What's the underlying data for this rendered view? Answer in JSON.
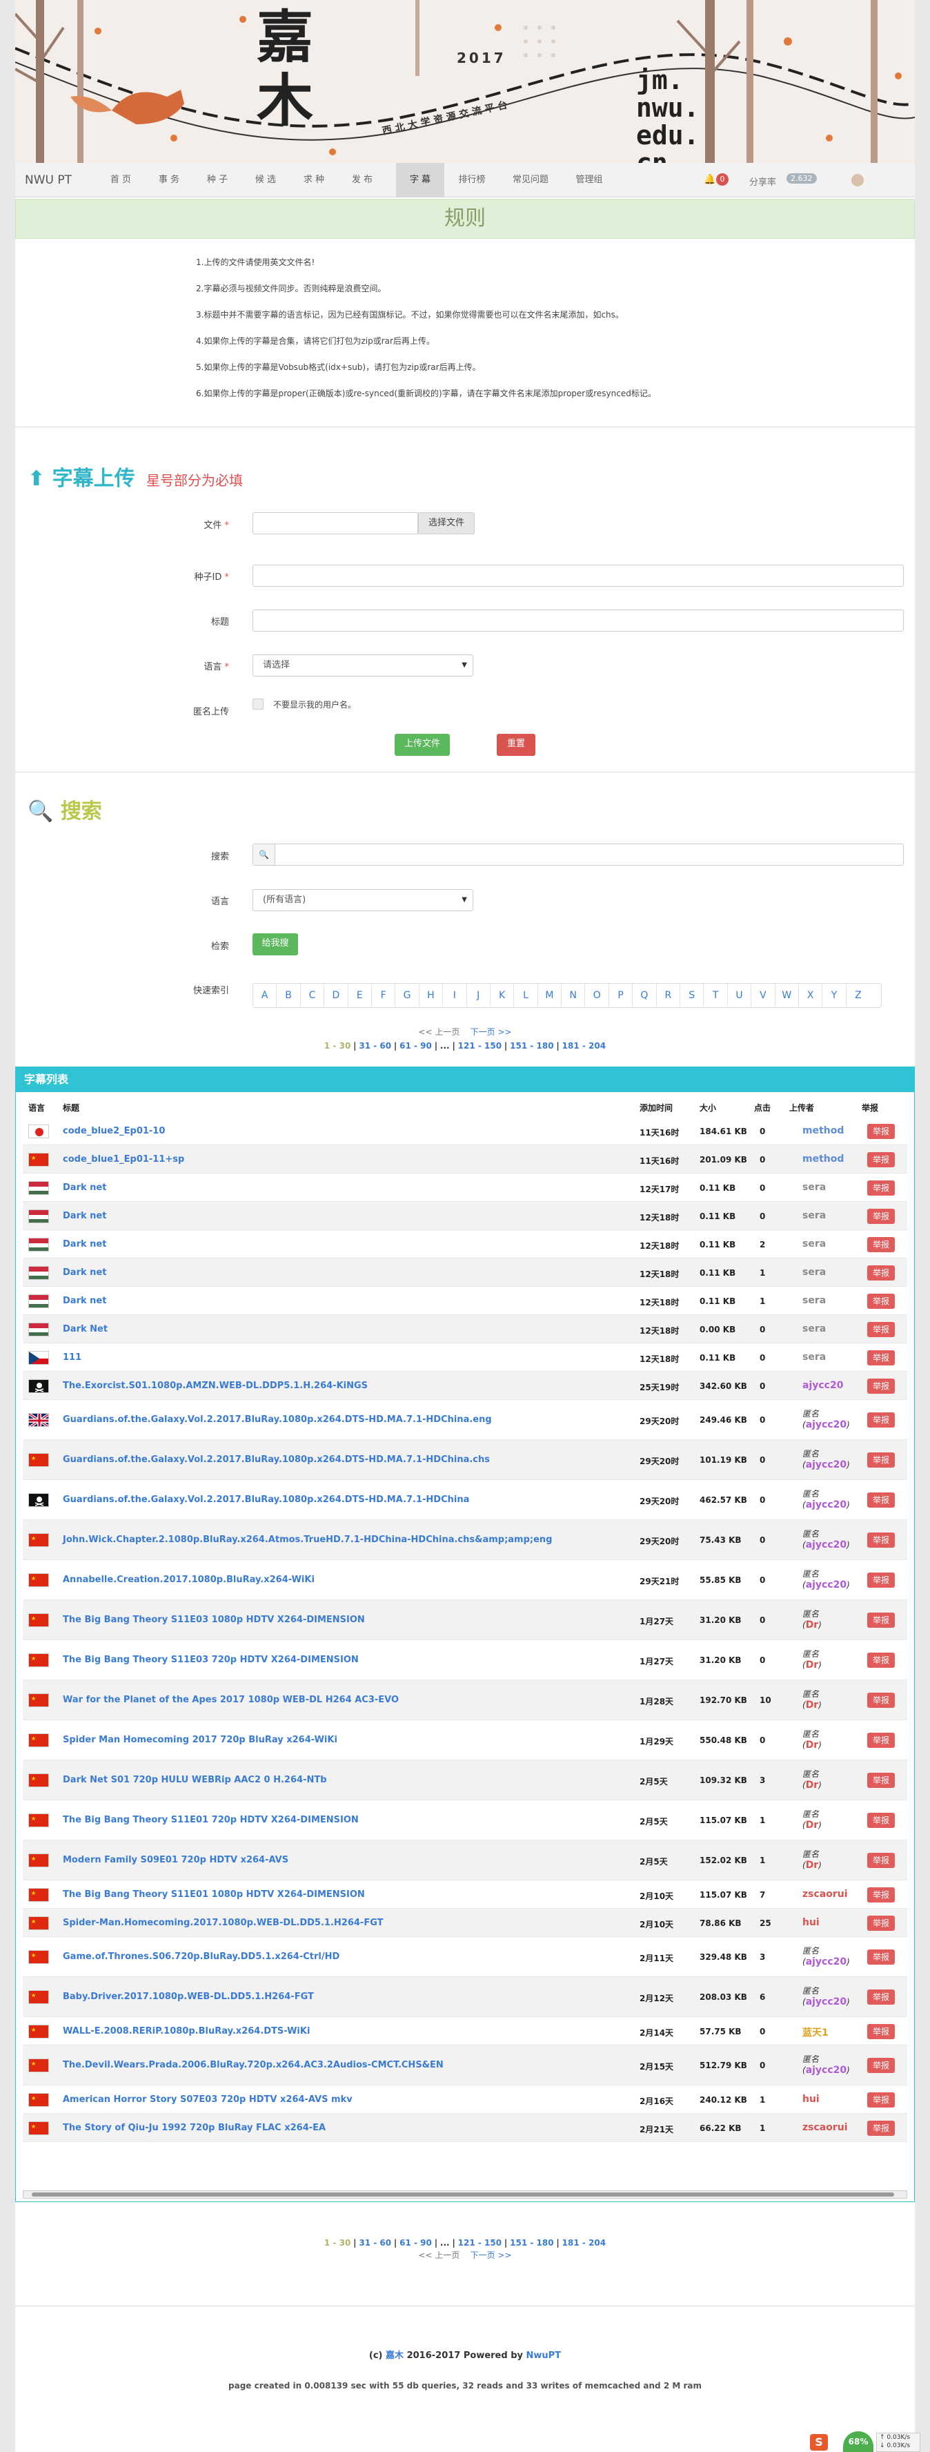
{
  "banner": {
    "title": "嘉木",
    "year": "2017",
    "subtitle": "西北大学资源交流平台",
    "domain": "jm.\nnwu.\nedu.\ncn."
  },
  "nav": {
    "logo": "NWU PT",
    "items": [
      "首 页",
      "事 务",
      "种 子",
      "候 选",
      "求 种",
      "发 布",
      "字 幕",
      "排行榜",
      "常见问题",
      "管理组"
    ],
    "active_index": 6,
    "notification_count": "0",
    "share_label": "分享率",
    "share_value": "2.632"
  },
  "rules": {
    "title": "规则",
    "items": [
      "1.上传的文件请使用英文文件名!",
      "2.字幕必须与视频文件同步。否则纯粹是浪费空间。",
      "3.标题中并不需要字幕的语言标记，因为已经有国旗标记。不过，如果你觉得需要也可以在文件名末尾添加，如chs。",
      "4.如果你上传的字幕是合集，请将它们打包为zip或rar后再上传。",
      "5.如果你上传的字幕是Vobsub格式(idx+sub)，请打包为zip或rar后再上传。",
      "6.如果你上传的字幕是proper(正确版本)或re-synced(重新调校的)字幕，请在字幕文件名末尾添加proper或resynced标记。"
    ]
  },
  "upload": {
    "title": "字幕上传",
    "note": "星号部分为必填",
    "file_label": "文件",
    "choose_file": "选择文件",
    "torrent_label": "种子ID",
    "title_label": "标题",
    "lang_label": "语言",
    "lang_placeholder": "请选择",
    "anon_label": "匿名上传",
    "anon_text": "不要显示我的用户名。",
    "submit": "上传文件",
    "reset": "重置",
    "required_mark": "*"
  },
  "search": {
    "title": "搜索",
    "search_label": "搜索",
    "lang_label": "语言",
    "lang_value": "(所有语言)",
    "check_label": "检索",
    "check_button": "给我搜",
    "index_label": "快速索引",
    "letters": [
      "A",
      "B",
      "C",
      "D",
      "E",
      "F",
      "G",
      "H",
      "I",
      "J",
      "K",
      "L",
      "M",
      "N",
      "O",
      "P",
      "Q",
      "R",
      "S",
      "T",
      "U",
      "V",
      "W",
      "X",
      "Y",
      "Z"
    ]
  },
  "pager": {
    "prev": "<< 上一页",
    "next": "下一页 >>",
    "current": "1 - 30",
    "pages": [
      "31 - 60",
      "61 - 90",
      "...",
      "121 - 150",
      "151 - 180",
      "181 - 204"
    ]
  },
  "list": {
    "title": "字幕列表",
    "columns": [
      "语言",
      "标题",
      "添加时间",
      "大小",
      "点击",
      "上传者",
      "举报"
    ],
    "anonymous": "匿名",
    "report": "举报",
    "rows": [
      {
        "flag": "jp",
        "title": "code_blue2_Ep01-10",
        "time": "11天16时",
        "size": "184.61 KB",
        "clicks": "0",
        "uploader": "method",
        "ucolor": "#5b8bd9",
        "anon": false
      },
      {
        "flag": "cn",
        "title": "code_blue1_Ep01-11+sp",
        "time": "11天16时",
        "size": "201.09 KB",
        "clicks": "0",
        "uploader": "method",
        "ucolor": "#5b8bd9",
        "anon": false
      },
      {
        "flag": "hu",
        "title": "Dark net",
        "time": "12天17时",
        "size": "0.11 KB",
        "clicks": "0",
        "uploader": "sera",
        "ucolor": "#8a8a8a",
        "anon": false
      },
      {
        "flag": "hu",
        "title": "Dark net",
        "time": "12天18时",
        "size": "0.11 KB",
        "clicks": "0",
        "uploader": "sera",
        "ucolor": "#8a8a8a",
        "anon": false
      },
      {
        "flag": "hu",
        "title": "Dark net",
        "time": "12天18时",
        "size": "0.11 KB",
        "clicks": "2",
        "uploader": "sera",
        "ucolor": "#8a8a8a",
        "anon": false
      },
      {
        "flag": "hu",
        "title": "Dark net",
        "time": "12天18时",
        "size": "0.11 KB",
        "clicks": "1",
        "uploader": "sera",
        "ucolor": "#8a8a8a",
        "anon": false
      },
      {
        "flag": "hu",
        "title": "Dark net",
        "time": "12天18时",
        "size": "0.11 KB",
        "clicks": "1",
        "uploader": "sera",
        "ucolor": "#8a8a8a",
        "anon": false
      },
      {
        "flag": "hu",
        "title": "Dark Net",
        "time": "12天18时",
        "size": "0.00 KB",
        "clicks": "0",
        "uploader": "sera",
        "ucolor": "#8a8a8a",
        "anon": false
      },
      {
        "flag": "cz",
        "title": "111",
        "time": "12天18时",
        "size": "0.11 KB",
        "clicks": "0",
        "uploader": "sera",
        "ucolor": "#8a8a8a",
        "anon": false
      },
      {
        "flag": "pirate",
        "title": "The.Exorcist.S01.1080p.AMZN.WEB-DL.DDP5.1.H.264-KiNGS",
        "time": "25天19时",
        "size": "342.60 KB",
        "clicks": "0",
        "uploader": "ajycc20",
        "ucolor": "#b05ad6",
        "anon": false
      },
      {
        "flag": "gb",
        "title": "Guardians.of.the.Galaxy.Vol.2.2017.BluRay.1080p.x264.DTS-HD.MA.7.1-HDChina.eng",
        "time": "29天20时",
        "size": "249.46 KB",
        "clicks": "0",
        "uploader": "ajycc20",
        "ucolor": "#b05ad6",
        "anon": true
      },
      {
        "flag": "cn",
        "title": "Guardians.of.the.Galaxy.Vol.2.2017.BluRay.1080p.x264.DTS-HD.MA.7.1-HDChina.chs",
        "time": "29天20时",
        "size": "101.19 KB",
        "clicks": "0",
        "uploader": "ajycc20",
        "ucolor": "#b05ad6",
        "anon": true
      },
      {
        "flag": "pirate",
        "title": "Guardians.of.the.Galaxy.Vol.2.2017.BluRay.1080p.x264.DTS-HD.MA.7.1-HDChina",
        "time": "29天20时",
        "size": "462.57 KB",
        "clicks": "0",
        "uploader": "ajycc20",
        "ucolor": "#b05ad6",
        "anon": true
      },
      {
        "flag": "cn",
        "title": "John.Wick.Chapter.2.1080p.BluRay.x264.Atmos.TrueHD.7.1-HDChina-HDChina.chs&amp;amp;eng",
        "time": "29天20时",
        "size": "75.43 KB",
        "clicks": "0",
        "uploader": "ajycc20",
        "ucolor": "#b05ad6",
        "anon": true
      },
      {
        "flag": "cn",
        "title": "Annabelle.Creation.2017.1080p.BluRay.x264-WiKi",
        "time": "29天21时",
        "size": "55.85 KB",
        "clicks": "0",
        "uploader": "ajycc20",
        "ucolor": "#b05ad6",
        "anon": true
      },
      {
        "flag": "cn",
        "title": "The Big Bang Theory  S11E03 1080p HDTV X264-DIMENSION",
        "time": "1月27天",
        "size": "31.20 KB",
        "clicks": "0",
        "uploader": "Dr",
        "ucolor": "#d9534f",
        "anon": true
      },
      {
        "flag": "cn",
        "title": "The Big Bang Theory  S11E03 720p HDTV X264-DIMENSION",
        "time": "1月27天",
        "size": "31.20 KB",
        "clicks": "0",
        "uploader": "Dr",
        "ucolor": "#d9534f",
        "anon": true
      },
      {
        "flag": "cn",
        "title": "War for the Planet of the Apes 2017 1080p WEB-DL H264 AC3-EVO",
        "time": "1月28天",
        "size": "192.70 KB",
        "clicks": "10",
        "uploader": "Dr",
        "ucolor": "#d9534f",
        "anon": true
      },
      {
        "flag": "cn",
        "title": "Spider Man Homecoming 2017 720p BluRay x264-WiKi",
        "time": "1月29天",
        "size": "550.48 KB",
        "clicks": "0",
        "uploader": "Dr",
        "ucolor": "#d9534f",
        "anon": true
      },
      {
        "flag": "cn",
        "title": "Dark Net S01 720p HULU WEBRip AAC2 0 H.264-NTb",
        "time": "2月5天",
        "size": "109.32 KB",
        "clicks": "3",
        "uploader": "Dr",
        "ucolor": "#d9534f",
        "anon": true
      },
      {
        "flag": "cn",
        "title": "The Big Bang Theory  S11E01 720p HDTV X264-DIMENSION",
        "time": "2月5天",
        "size": "115.07 KB",
        "clicks": "1",
        "uploader": "Dr",
        "ucolor": "#d9534f",
        "anon": true
      },
      {
        "flag": "cn",
        "title": "Modern Family  S09E01 720p HDTV x264-AVS",
        "time": "2月5天",
        "size": "152.02 KB",
        "clicks": "1",
        "uploader": "Dr",
        "ucolor": "#d9534f",
        "anon": true
      },
      {
        "flag": "cn",
        "title": "The Big Bang Theory  S11E01 1080p HDTV X264-DIMENSION",
        "time": "2月10天",
        "size": "115.07 KB",
        "clicks": "7",
        "uploader": "zscaorui",
        "ucolor": "#d9534f",
        "anon": false
      },
      {
        "flag": "cn",
        "title": "Spider-Man.Homecoming.2017.1080p.WEB-DL.DD5.1.H264-FGT",
        "time": "2月10天",
        "size": "78.86 KB",
        "clicks": "25",
        "uploader": "hui",
        "ucolor": "#d9534f",
        "anon": false
      },
      {
        "flag": "cn",
        "title": "Game.of.Thrones.S06.720p.BluRay.DD5.1.x264-Ctrl/HD",
        "time": "2月11天",
        "size": "329.48 KB",
        "clicks": "3",
        "uploader": "ajycc20",
        "ucolor": "#b05ad6",
        "anon": true
      },
      {
        "flag": "cn",
        "title": "Baby.Driver.2017.1080p.WEB-DL.DD5.1.H264-FGT",
        "time": "2月12天",
        "size": "208.03 KB",
        "clicks": "6",
        "uploader": "ajycc20",
        "ucolor": "#b05ad6",
        "anon": true
      },
      {
        "flag": "cn",
        "title": "WALL-E.2008.RERiP.1080p.BluRay.x264.DTS-WiKi",
        "time": "2月14天",
        "size": "57.75 KB",
        "clicks": "0",
        "uploader": "蓝天1",
        "ucolor": "#e0a020",
        "anon": false
      },
      {
        "flag": "cn",
        "title": "The.Devil.Wears.Prada.2006.BluRay.720p.x264.AC3.2Audios-CMCT.CHS&EN",
        "time": "2月15天",
        "size": "512.79 KB",
        "clicks": "0",
        "uploader": "ajycc20",
        "ucolor": "#b05ad6",
        "anon": true
      },
      {
        "flag": "cn",
        "title": "American Horror Story S07E03 720p HDTV x264-AVS mkv",
        "time": "2月16天",
        "size": "240.12 KB",
        "clicks": "1",
        "uploader": "hui",
        "ucolor": "#d9534f",
        "anon": false
      },
      {
        "flag": "cn",
        "title": "The Story of Qiu-Ju 1992 720p BluRay FLAC x264-EA",
        "time": "2月21天",
        "size": "66.22 KB",
        "clicks": "1",
        "uploader": "zscaorui",
        "ucolor": "#d9534f",
        "anon": false
      }
    ]
  },
  "footer": {
    "copy_prefix": "(c)",
    "site": "嘉木",
    "copy_mid": "2016-2017 Powered by",
    "powered": "NwuPT",
    "stats": "page created in 0.008139 sec with 55 db queries, 32 reads and 33 writes of memcached and 2 M ram"
  },
  "tray": {
    "percent": "68%",
    "up": "0.03K/s",
    "down": "0.03K/s"
  }
}
